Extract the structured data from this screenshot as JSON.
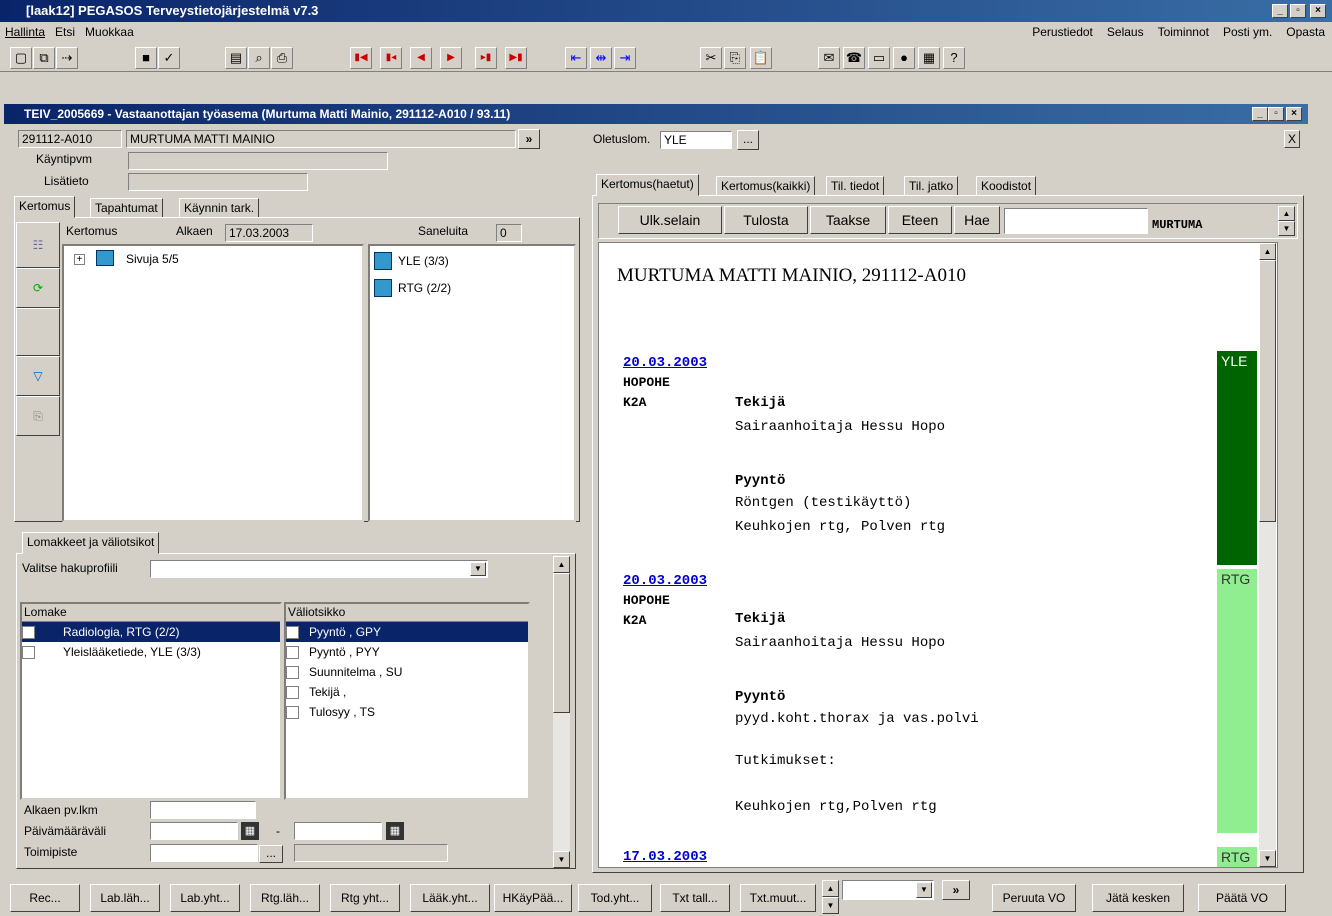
{
  "window": {
    "title": "[laak12] PEGASOS Terveystietojärjestelmä v7.3"
  },
  "menu_left": [
    "Hallinta",
    "Etsi",
    "Muokkaa"
  ],
  "menu_right": [
    "Perustiedot",
    "Selaus",
    "Toiminnot",
    "Posti ym.",
    "Opasta"
  ],
  "subwindow": {
    "title": "TEIV_2005669 - Vastaanottajan työasema   (Murtuma Matti Mainio, 291112-A010 / 93.11)"
  },
  "patient": {
    "id": "291112-A010",
    "name": "MURTUMA MATTI MAINIO",
    "kayntipvm_label": "Käyntipvm",
    "lisatieto_label": "Lisätieto",
    "oletuslom_label": "Oletuslom.",
    "oletuslom_value": "YLE",
    "more_btn": "...",
    "close_x": "X",
    "arrow_btn": "»"
  },
  "left_tabs": [
    "Kertomus",
    "Tapahtumat",
    "Käynnin tark."
  ],
  "kertomus": {
    "kertomus_label": "Kertomus",
    "alkaen_label": "Alkaen",
    "alkaen_value": "17.03.2003",
    "saneluita_label": "Saneluita",
    "saneluita_value": "0",
    "tree_expander": "+",
    "tree_item": "Sivuja 5/5",
    "list_items": [
      "YLE (3/3)",
      "RTG (2/2)"
    ]
  },
  "lomakkeet": {
    "tab_label": "Lomakkeet ja väliotsikot",
    "hakuprofiili_label": "Valitse hakuprofiili",
    "lomake_header": "Lomake",
    "valiotsikko_header": "Väliotsikko",
    "lomake_items": [
      "Radiologia, RTG (2/2)",
      "Yleislääketiede, YLE (3/3)"
    ],
    "valiotsikko_items": [
      "Pyyntö , GPY",
      "Pyyntö , PYY",
      "Suunnitelma , SU",
      "Tekijä ,",
      "Tulosyy , TS"
    ],
    "alkaen_pvlkm_label": "Alkaen pv.lkm",
    "paivamaaravali_label": "Päivämääräväli",
    "toimipiste_label": "Toimipiste",
    "dash": "-",
    "more_btn": "..."
  },
  "right_tabs": [
    "Kertomus(haetut)",
    "Kertomus(kaikki)",
    "Til. tiedot",
    "Til. jatko",
    "Koodistot"
  ],
  "browser_toolbar": {
    "buttons": [
      "Ulk.selain",
      "Tulosta",
      "Taakse",
      "Eteen",
      "Hae"
    ],
    "search_value": "",
    "tag": "MURTUMA"
  },
  "document": {
    "heading": "MURTUMA MATTI MAINIO, 291112-A010",
    "entries": [
      {
        "date": "20.03.2003",
        "unit": "HOPOHE",
        "dept": "K2A",
        "tekija_label": "Tekijä",
        "tekija": "Sairaanhoitaja Hessu Hopo",
        "pyynto_label": "Pyyntö",
        "lines": [
          "Röntgen (testikäyttö)",
          "Keuhkojen rtg, Polven rtg"
        ],
        "tag": "YLE",
        "tag_color": "#006400"
      },
      {
        "date": "20.03.2003",
        "unit": "HOPOHE",
        "dept": "K2A",
        "tekija_label": "Tekijä",
        "tekija": "Sairaanhoitaja Hessu Hopo",
        "pyynto_label": "Pyyntö",
        "lines": [
          "pyyd.koht.thorax ja vas.polvi",
          "Tutkimukset:",
          "Keuhkojen rtg,Polven rtg"
        ],
        "tag": "RTG",
        "tag_color": "#90ee90"
      },
      {
        "date": "17.03.2003",
        "tag": "RTG",
        "tag_color": "#90ee90"
      }
    ]
  },
  "bottom_buttons": [
    "Rec...",
    "Lab.läh...",
    "Lab.yht...",
    "Rtg.läh...",
    "Rtg yht...",
    "Lääk.yht...",
    "HKäyPää...",
    "Tod.yht...",
    "Txt tall...",
    "Txt.muut...",
    "Peruuta VO",
    "Jätä kesken",
    "Päätä VO"
  ],
  "bottom_arrow": "»",
  "colors": {
    "title_start": "#0a246a",
    "title_end": "#3a6ea5",
    "link": "#0000cc",
    "yle_bar": "#006400",
    "rtg_bar": "#90ee90"
  }
}
